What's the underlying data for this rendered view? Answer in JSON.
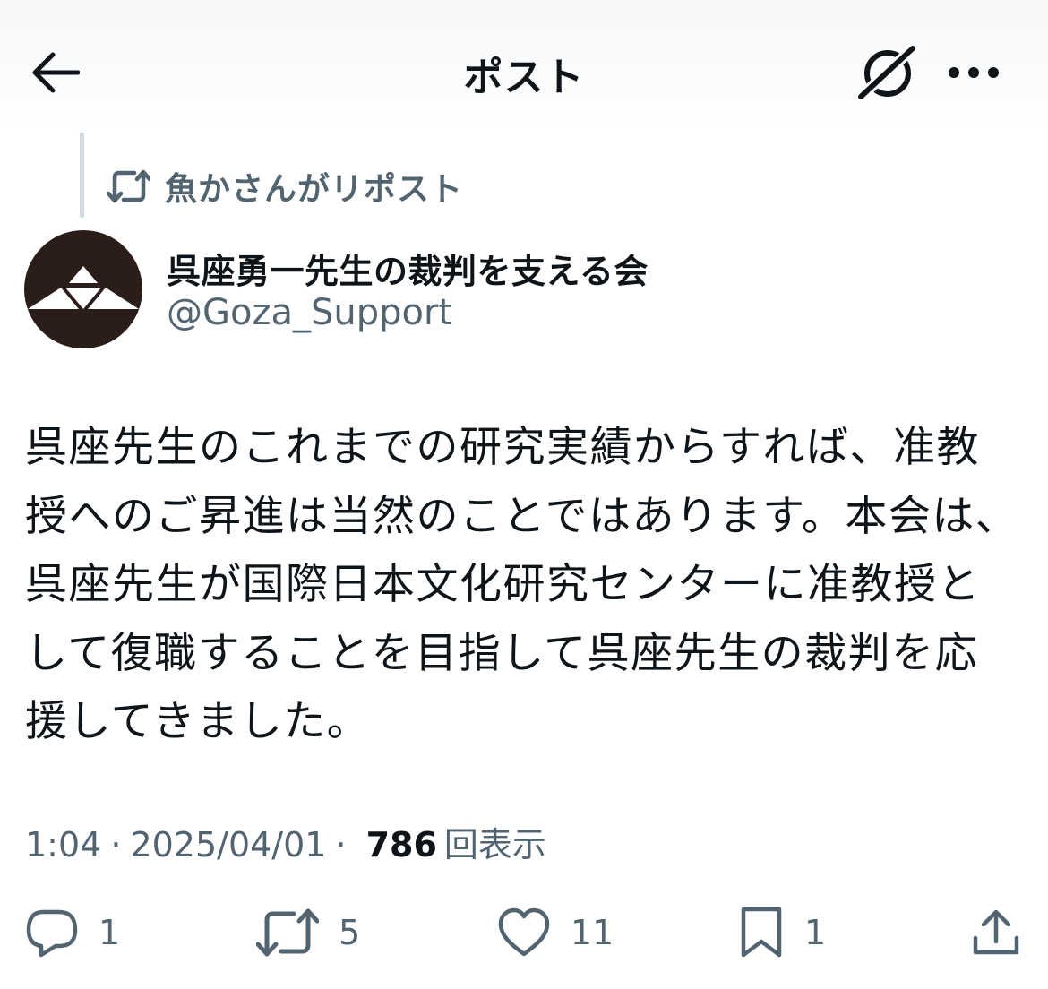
{
  "header": {
    "title": "ポスト"
  },
  "repost": {
    "label": "魚かさんがリポスト"
  },
  "author": {
    "display_name": "呉座勇一先生の裁判を支える会",
    "handle": "@Goza_Support"
  },
  "post": {
    "text": "呉座先生のこれまでの研究実績からすれば、准教授へのご昇進は当然のことではあります。本会は、呉座先生が国際日本文化研究センターに准教授として復職することを目指して呉座先生の裁判を応援してきました。",
    "time": "1:04",
    "date": "2025/04/01",
    "separator": "·",
    "views_count": "786",
    "views_label": "回表示"
  },
  "actions": {
    "reply_count": "1",
    "repost_count": "5",
    "like_count": "11",
    "bookmark_count": "1"
  },
  "icons": {
    "back": "arrow-left-icon",
    "grok": "grok-icon",
    "more": "more-dots-icon",
    "repost": "repost-icon",
    "reply": "reply-icon",
    "like": "heart-icon",
    "bookmark": "bookmark-icon",
    "share": "share-icon"
  },
  "colors": {
    "text": "#0f1419",
    "secondary": "#536471",
    "line": "#cfd9de",
    "avatar_bg": "#2a1d1a"
  }
}
